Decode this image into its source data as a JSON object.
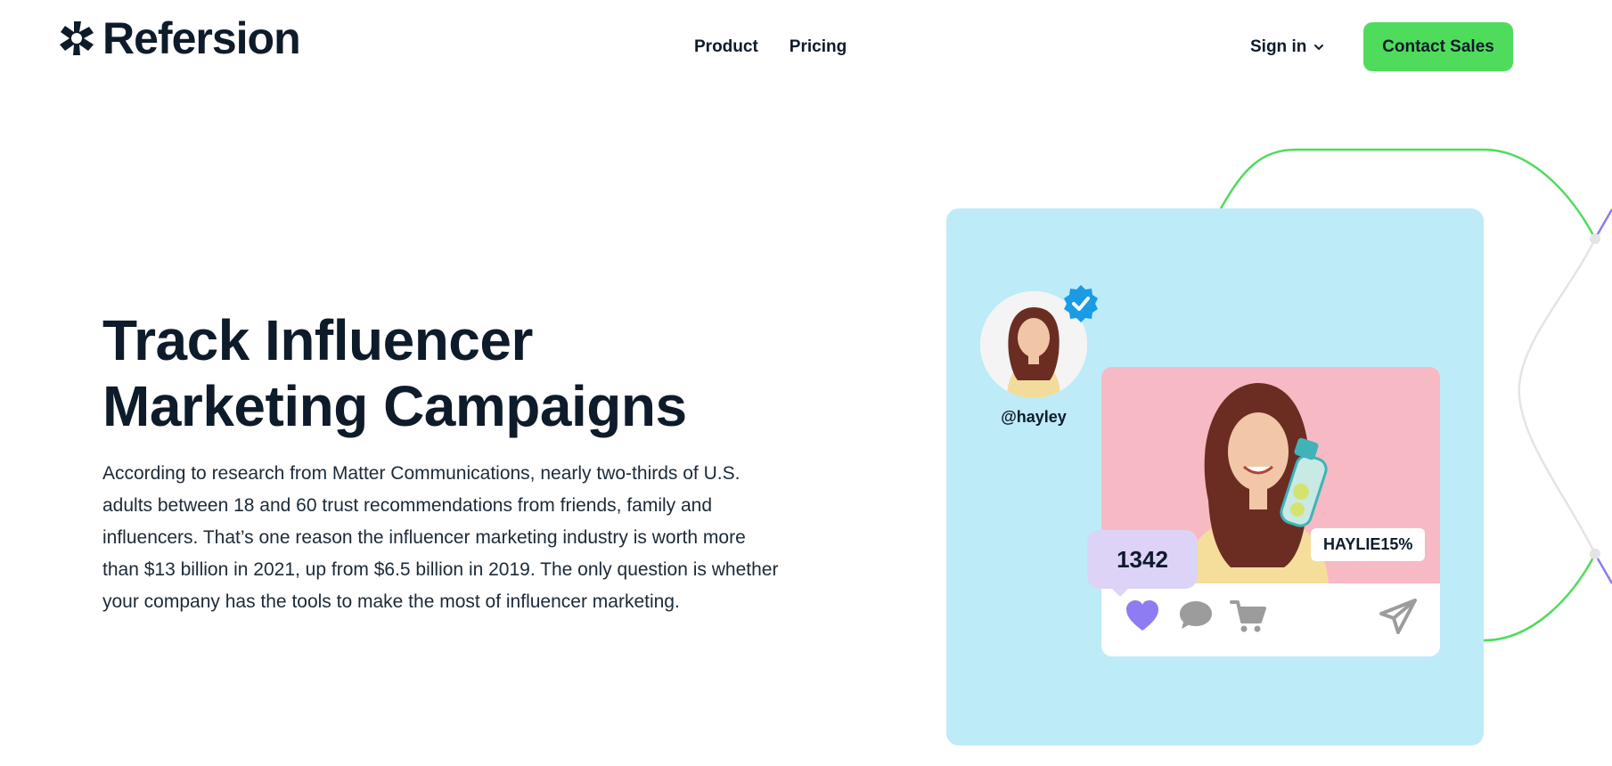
{
  "brand": {
    "name": "Refersion",
    "accent": "#4fdc5c"
  },
  "nav": {
    "items": [
      {
        "label": "Product"
      },
      {
        "label": "Pricing"
      }
    ],
    "signin_label": "Sign in",
    "cta_label": "Contact Sales"
  },
  "hero": {
    "title_line1": "Track Influencer",
    "title_line2": "Marketing Campaigns",
    "body": "According to research from Matter Communications, nearly two-thirds of U.S. adults between 18 and 60 trust recommendations from friends, family and influencers. That’s one reason the influencer marketing industry is worth more than $13 billion in 2021, up from $6.5 billion in 2019. The only question is whether your company has the tools to make the most of influencer marketing."
  },
  "illustration": {
    "handle": "@hayley",
    "likes": "1342",
    "promo_code": "HAYLIE15%",
    "card_color": "#bdebf8",
    "photo_color": "#f7b9c3",
    "likes_bubble_color": "#ddd3f7",
    "icons": [
      "verified-badge-icon",
      "heart-icon",
      "comment-icon",
      "cart-icon",
      "send-icon"
    ]
  }
}
